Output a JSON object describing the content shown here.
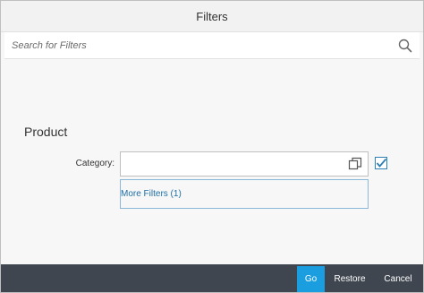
{
  "dialog": {
    "title": "Filters"
  },
  "search": {
    "placeholder": "Search for Filters",
    "value": "",
    "icon": "search-icon"
  },
  "group": {
    "title": "Product",
    "fields": [
      {
        "label": "Category:",
        "value": "",
        "value_help_icon": "value-help-icon",
        "checked": true
      }
    ],
    "more_filters_label": "More Filters (1)"
  },
  "footer": {
    "go_label": "Go",
    "restore_label": "Restore",
    "cancel_label": "Cancel"
  },
  "colors": {
    "accent": "#1a9ee0",
    "footer_bg": "#3f4650",
    "link": "#1f6ea3",
    "checkbox_border": "#2b7fb5"
  }
}
